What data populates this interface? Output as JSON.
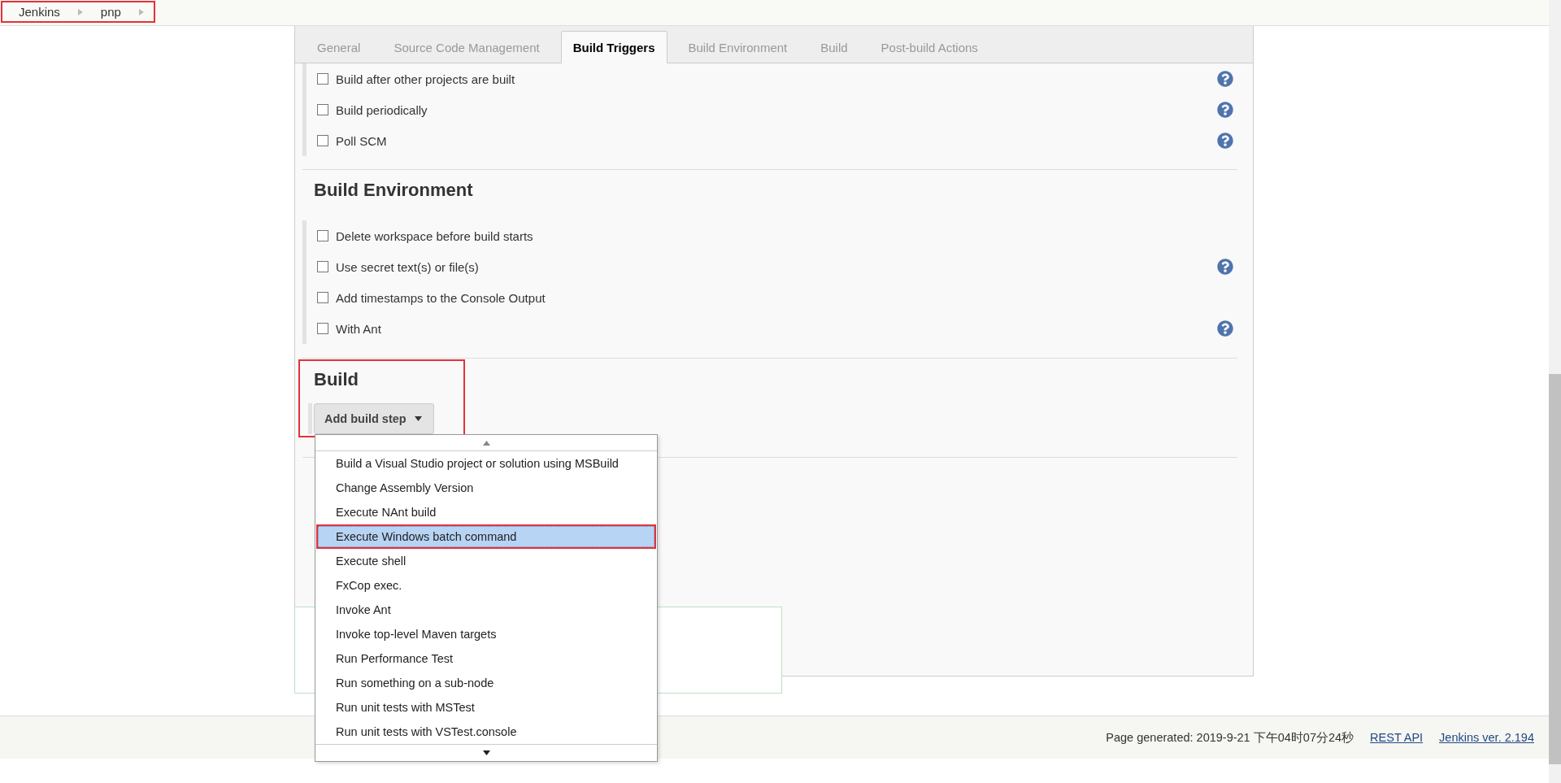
{
  "breadcrumbs": {
    "highlighted": true,
    "items": [
      {
        "label": "Jenkins"
      },
      {
        "label": "pnp"
      }
    ]
  },
  "tabs": [
    {
      "label": "General",
      "selected": false
    },
    {
      "label": "Source Code Management",
      "selected": false
    },
    {
      "label": "Build Triggers",
      "selected": true
    },
    {
      "label": "Build Environment",
      "selected": false
    },
    {
      "label": "Build",
      "selected": false
    },
    {
      "label": "Post-build Actions",
      "selected": false
    }
  ],
  "build_triggers": {
    "options": [
      {
        "label": "Build after other projects are built",
        "checked": false,
        "help": true
      },
      {
        "label": "Build periodically",
        "checked": false,
        "help": true
      },
      {
        "label": "Poll SCM",
        "checked": false,
        "help": true
      }
    ]
  },
  "build_environment": {
    "title": "Build Environment",
    "options": [
      {
        "label": "Delete workspace before build starts",
        "checked": false,
        "help": false
      },
      {
        "label": "Use secret text(s) or file(s)",
        "checked": false,
        "help": true
      },
      {
        "label": "Add timestamps to the Console Output",
        "checked": false,
        "help": false
      },
      {
        "label": "With Ant",
        "checked": false,
        "help": true
      }
    ]
  },
  "build": {
    "title": "Build",
    "highlighted": true,
    "add_button": "Add build step",
    "menu": {
      "items": [
        {
          "label": "Build a Visual Studio project or solution using MSBuild",
          "selected": false,
          "highlighted": false
        },
        {
          "label": "Change Assembly Version",
          "selected": false,
          "highlighted": false
        },
        {
          "label": "Execute NAnt build",
          "selected": false,
          "highlighted": false
        },
        {
          "label": "Execute Windows batch command",
          "selected": true,
          "highlighted": true
        },
        {
          "label": "Execute shell",
          "selected": false,
          "highlighted": false
        },
        {
          "label": "FxCop exec.",
          "selected": false,
          "highlighted": false
        },
        {
          "label": "Invoke Ant",
          "selected": false,
          "highlighted": false
        },
        {
          "label": "Invoke top-level Maven targets",
          "selected": false,
          "highlighted": false
        },
        {
          "label": "Run Performance Test",
          "selected": false,
          "highlighted": false
        },
        {
          "label": "Run something on a sub-node",
          "selected": false,
          "highlighted": false
        },
        {
          "label": "Run unit tests with MSTest",
          "selected": false,
          "highlighted": false
        },
        {
          "label": "Run unit tests with VSTest.console",
          "selected": false,
          "highlighted": false
        }
      ]
    }
  },
  "footer": {
    "generated": "Page generated: 2019-9-21 下午04时07分24秒",
    "links": [
      "REST API",
      "Jenkins ver. 2.194"
    ]
  }
}
